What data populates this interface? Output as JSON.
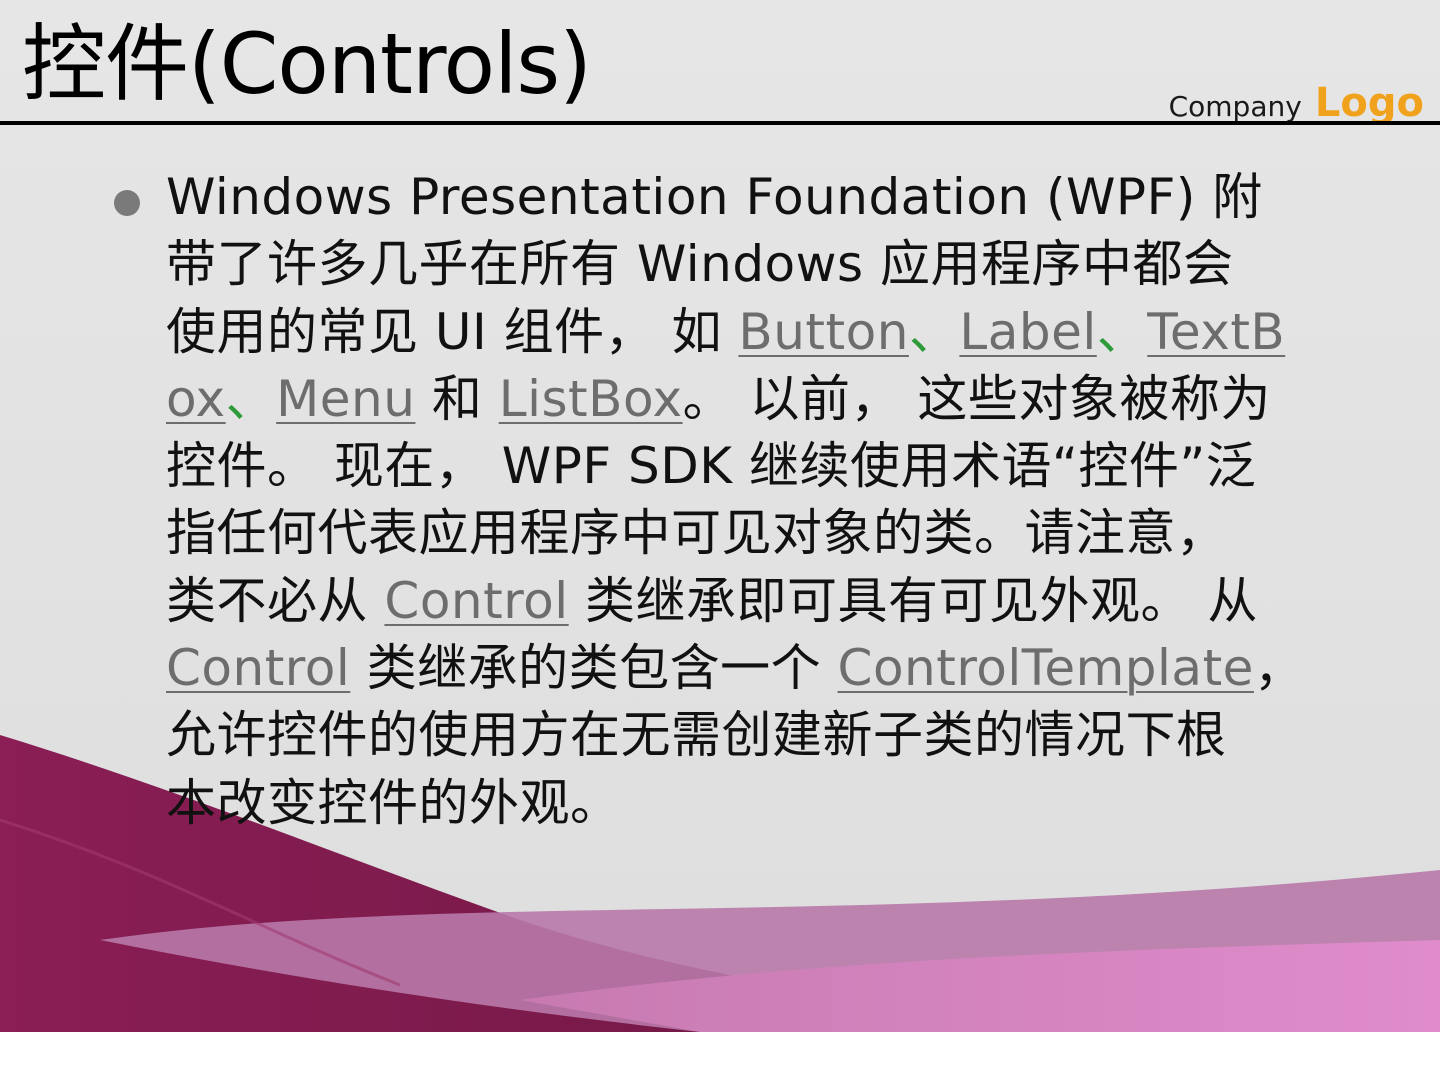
{
  "slide": {
    "title": "控件(Controls)",
    "company": "Company",
    "logo": "Logo",
    "colors": {
      "background": "#e2e2e2",
      "logo": "#f0a21c",
      "accent_dark": "#7a1a4a",
      "accent_light": "#e070b8",
      "link": "#6d6d6d"
    },
    "body": {
      "line1": "Windows Presentation Foundation (WPF) 附",
      "line2": "带了许多几乎在所有 Windows 应用程序中都会",
      "line3_a": "使用的常见 UI 组件， 如 ",
      "link_button": "Button",
      "sep1": "、",
      "link_label": "Label",
      "sep2": "、",
      "link_textbox_1": "TextB",
      "link_textbox_2": "ox",
      "sep3": "、",
      "link_menu": "Menu",
      "line4_and": " 和 ",
      "link_listbox": "ListBox",
      "line4_b": "。 以前， 这些对象被称为",
      "line5": "控件。 现在， WPF SDK 继续使用术语“控件”泛",
      "line6": "指任何代表应用程序中可见对象的类。请注意，",
      "line7_a": "类不必从 ",
      "link_control_1": "Control",
      "line7_b": " 类继承即可具有可见外观。 从",
      "link_control_2": "Control",
      "line8_b": " 类继承的类包含一个 ",
      "link_template": "ControlTemplate",
      "line8_c": "，",
      "line9": "允许控件的使用方在无需创建新子类的情况下根",
      "line10": "本改变控件的外观。"
    }
  }
}
